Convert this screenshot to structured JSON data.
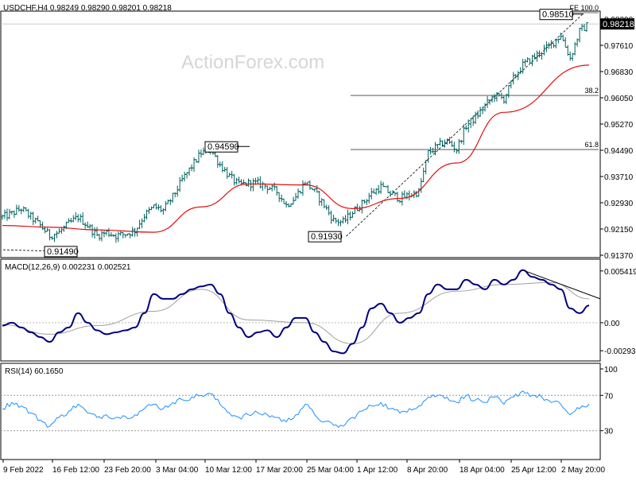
{
  "header": {
    "main": "USDCHF,H4  0.98249 0.98290 0.98201 0.98218",
    "macd": "MACD(12,26,9) 0.002231 0.002521",
    "rsi": "RSI(14) 60.1650"
  },
  "watermark": "ActionForex.com",
  "colors": {
    "background": "#ffffff",
    "bars": "#006060",
    "sma": "#e01010",
    "macd": "#000080",
    "signal": "#a0a0a0",
    "rsi": "#1e90ff",
    "fib": "#404040",
    "trend": "#000000"
  },
  "chart_data": [
    {
      "type": "ohlc",
      "symbol": "USDCHF",
      "timeframe": "H4",
      "ylim": [
        0.9137,
        0.9855
      ],
      "y_ticks": [
        "0.98390",
        "0.97610",
        "0.96830",
        "0.96050",
        "0.95270",
        "0.94490",
        "0.93710",
        "0.92930",
        "0.92150",
        "0.91370"
      ],
      "x_ticks": [
        "9 Feb 2022",
        "16 Feb 12:00",
        "23 Feb 20:00",
        "3 Mar 04:00",
        "10 Mar 12:00",
        "17 Mar 20:00",
        "25 Mar 04:00",
        "1 Apr 12:00",
        "8 Apr 20:00",
        "18 Apr 04:00",
        "25 Apr 12:00",
        "2 May 20:00"
      ],
      "close_keypoints": [
        [
          "9 Feb 2022",
          0.925
        ],
        [
          "10 Feb",
          0.926
        ],
        [
          "11 Feb",
          0.9275
        ],
        [
          "14 Feb",
          0.925
        ],
        [
          "15 Feb",
          0.9225
        ],
        [
          "16 Feb 12:00",
          0.9195
        ],
        [
          "17 Feb",
          0.9205
        ],
        [
          "18 Feb",
          0.923
        ],
        [
          "21 Feb",
          0.925
        ],
        [
          "22 Feb",
          0.9225
        ],
        [
          "23 Feb 20:00",
          0.9195
        ],
        [
          "24 Feb",
          0.9205
        ],
        [
          "25 Feb",
          0.9195
        ],
        [
          "28 Feb",
          0.92
        ],
        [
          "1 Mar",
          0.921
        ],
        [
          "2 Mar",
          0.9255
        ],
        [
          "3 Mar 04:00",
          0.928
        ],
        [
          "4 Mar",
          0.927
        ],
        [
          "7 Mar",
          0.931
        ],
        [
          "8 Mar",
          0.936
        ],
        [
          "9 Mar",
          0.94
        ],
        [
          "10 Mar 12:00",
          0.944
        ],
        [
          "11 Mar",
          0.945
        ],
        [
          "14 Mar",
          0.9405
        ],
        [
          "15 Mar",
          0.937
        ],
        [
          "16 Mar",
          0.9345
        ],
        [
          "17 Mar 20:00",
          0.935
        ],
        [
          "18 Mar",
          0.935
        ],
        [
          "21 Mar",
          0.934
        ],
        [
          "22 Mar",
          0.9325
        ],
        [
          "23 Mar",
          0.9285
        ],
        [
          "24 Mar",
          0.931
        ],
        [
          "25 Mar 04:00",
          0.9355
        ],
        [
          "28 Mar",
          0.9325
        ],
        [
          "29 Mar",
          0.9285
        ],
        [
          "30 Mar",
          0.924
        ],
        [
          "31 Mar",
          0.9235
        ],
        [
          "1 Apr 12:00",
          0.9265
        ],
        [
          "4 Apr",
          0.929
        ],
        [
          "5 Apr",
          0.932
        ],
        [
          "6 Apr",
          0.934
        ],
        [
          "7 Apr",
          0.932
        ],
        [
          "8 Apr 20:00",
          0.9305
        ],
        [
          "11 Apr",
          0.9315
        ],
        [
          "12 Apr",
          0.9325
        ],
        [
          "13 Apr",
          0.944
        ],
        [
          "14 Apr",
          0.946
        ],
        [
          "15 Apr",
          0.9475
        ],
        [
          "18 Apr 04:00",
          0.945
        ],
        [
          "19 Apr",
          0.952
        ],
        [
          "20 Apr",
          0.9545
        ],
        [
          "21 Apr",
          0.958
        ],
        [
          "22 Apr",
          0.961
        ],
        [
          "25 Apr 12:00",
          0.96
        ],
        [
          "26 Apr",
          0.966
        ],
        [
          "27 Apr",
          0.97
        ],
        [
          "28 Apr",
          0.972
        ],
        [
          "29 Apr",
          0.974
        ],
        [
          "2 May 20:00",
          0.976
        ],
        [
          "3 May",
          0.979
        ],
        [
          "4 May",
          0.972
        ],
        [
          "5 May",
          0.98
        ],
        [
          "6 May",
          0.9822
        ]
      ],
      "sma_keypoints": [
        [
          "9 Feb 2022",
          0.9225
        ],
        [
          "16 Feb 12:00",
          0.922
        ],
        [
          "23 Feb 20:00",
          0.9212
        ],
        [
          "3 Mar 04:00",
          0.9205
        ],
        [
          "10 Mar 12:00",
          0.928
        ],
        [
          "17 Mar 20:00",
          0.9348
        ],
        [
          "25 Mar 04:00",
          0.9345
        ],
        [
          "1 Apr 12:00",
          0.9275
        ],
        [
          "8 Apr 20:00",
          0.9305
        ],
        [
          "18 Apr 04:00",
          0.941
        ],
        [
          "25 Apr 12:00",
          0.956
        ],
        [
          "2 May 20:00",
          0.97
        ]
      ],
      "annotations": [
        {
          "text": "0.91490",
          "value": 0.9149
        },
        {
          "text": "0.94590",
          "value": 0.9459
        },
        {
          "text": "0.91930",
          "value": 0.9193
        },
        {
          "text": "0.98510",
          "value": 0.9851
        },
        {
          "text": "0.98218",
          "value": 0.98218
        }
      ],
      "fib_levels": [
        {
          "label": "FE 100.0",
          "value": 0.9855
        },
        {
          "label": "38.2",
          "value": 0.961
        },
        {
          "label": "61.8",
          "value": 0.945
        }
      ],
      "grid": false
    },
    {
      "type": "line",
      "name": "MACD(12,26,9)",
      "ylim": [
        -0.0035,
        0.0059
      ],
      "y_ticks": [
        "0.005419",
        "0.00",
        "-0.00293"
      ],
      "macd_keypoints": [
        [
          "9 Feb 2022",
          -0.0003
        ],
        [
          "10 Feb",
          0.0
        ],
        [
          "11 Feb",
          -0.0005
        ],
        [
          "14 Feb",
          -0.001
        ],
        [
          "15 Feb",
          -0.0015
        ],
        [
          "16 Feb 12:00",
          -0.002
        ],
        [
          "17 Feb",
          -0.001
        ],
        [
          "18 Feb",
          -0.0005
        ],
        [
          "21 Feb",
          0.001
        ],
        [
          "22 Feb",
          0.0
        ],
        [
          "23 Feb 20:00",
          -0.0008
        ],
        [
          "24 Feb",
          -0.0012
        ],
        [
          "25 Feb",
          -0.001
        ],
        [
          "28 Feb",
          -0.0008
        ],
        [
          "1 Mar",
          -0.0005
        ],
        [
          "2 Mar",
          0.001
        ],
        [
          "3 Mar 04:00",
          0.003
        ],
        [
          "4 Mar",
          0.0025
        ],
        [
          "7 Mar",
          0.0025
        ],
        [
          "8 Mar",
          0.003
        ],
        [
          "9 Mar",
          0.0035
        ],
        [
          "10 Mar 12:00",
          0.0038
        ],
        [
          "11 Mar",
          0.004
        ],
        [
          "14 Mar",
          0.003
        ],
        [
          "15 Mar",
          0.001
        ],
        [
          "16 Mar",
          -0.0005
        ],
        [
          "17 Mar 20:00",
          -0.0015
        ],
        [
          "18 Mar",
          -0.001
        ],
        [
          "21 Mar",
          -0.0008
        ],
        [
          "22 Mar",
          -0.0015
        ],
        [
          "23 Mar",
          -0.0005
        ],
        [
          "24 Mar",
          0.0005
        ],
        [
          "25 Mar 04:00",
          0.0005
        ],
        [
          "28 Mar",
          -0.001
        ],
        [
          "29 Mar",
          -0.002
        ],
        [
          "30 Mar",
          -0.003
        ],
        [
          "31 Mar",
          -0.0032
        ],
        [
          "1 Apr 12:00",
          -0.0022
        ],
        [
          "4 Apr",
          -0.0005
        ],
        [
          "5 Apr",
          0.0015
        ],
        [
          "6 Apr",
          0.002
        ],
        [
          "7 Apr",
          0.001
        ],
        [
          "8 Apr 20:00",
          0.0
        ],
        [
          "11 Apr",
          0.0005
        ],
        [
          "12 Apr",
          0.001
        ],
        [
          "13 Apr",
          0.003
        ],
        [
          "14 Apr",
          0.004
        ],
        [
          "15 Apr",
          0.0035
        ],
        [
          "18 Apr 04:00",
          0.0035
        ],
        [
          "19 Apr",
          0.0045
        ],
        [
          "20 Apr",
          0.004
        ],
        [
          "21 Apr",
          0.0035
        ],
        [
          "22 Apr",
          0.0045
        ],
        [
          "25 Apr 12:00",
          0.004
        ],
        [
          "26 Apr",
          0.0045
        ],
        [
          "27 Apr",
          0.0055
        ],
        [
          "28 Apr",
          0.0048
        ],
        [
          "29 Apr",
          0.0045
        ],
        [
          "2 May 20:00",
          0.004
        ],
        [
          "3 May",
          0.0035
        ],
        [
          "4 May",
          0.0015
        ],
        [
          "5 May",
          0.001
        ],
        [
          "6 May",
          0.0018
        ]
      ],
      "signal_keypoints": [
        [
          "9 Feb 2022",
          -0.0002
        ],
        [
          "16 Feb 12:00",
          -0.0012
        ],
        [
          "23 Feb 20:00",
          -0.0003
        ],
        [
          "3 Mar 04:00",
          0.0012
        ],
        [
          "10 Mar 12:00",
          0.0035
        ],
        [
          "17 Mar 20:00",
          0.0003
        ],
        [
          "25 Mar 04:00",
          0.0
        ],
        [
          "1 Apr 12:00",
          -0.0022
        ],
        [
          "8 Apr 20:00",
          0.001
        ],
        [
          "18 Apr 04:00",
          0.0033
        ],
        [
          "25 Apr 12:00",
          0.004
        ],
        [
          "2 May 20:00",
          0.0042
        ],
        [
          "6 May",
          0.0025
        ]
      ],
      "trendline": [
        [
          "27 Apr",
          0.0055
        ],
        [
          "6 May",
          0.003
        ]
      ]
    },
    {
      "type": "line",
      "name": "RSI(14)",
      "ylim": [
        0,
        100
      ],
      "y_ticks": [
        "100",
        "70",
        "30"
      ],
      "levels": [
        70,
        30
      ],
      "rsi_keypoints": [
        [
          "9 Feb 2022",
          55
        ],
        [
          "10 Feb",
          62
        ],
        [
          "11 Feb",
          58
        ],
        [
          "14 Feb",
          50
        ],
        [
          "15 Feb",
          42
        ],
        [
          "16 Feb 12:00",
          35
        ],
        [
          "17 Feb",
          45
        ],
        [
          "18 Feb",
          52
        ],
        [
          "21 Feb",
          60
        ],
        [
          "22 Feb",
          50
        ],
        [
          "23 Feb 20:00",
          45
        ],
        [
          "24 Feb",
          48
        ],
        [
          "25 Feb",
          45
        ],
        [
          "28 Feb",
          46
        ],
        [
          "1 Mar",
          48
        ],
        [
          "2 Mar",
          55
        ],
        [
          "3 Mar 04:00",
          60
        ],
        [
          "4 Mar",
          55
        ],
        [
          "7 Mar",
          62
        ],
        [
          "8 Mar",
          65
        ],
        [
          "9 Mar",
          68
        ],
        [
          "10 Mar 12:00",
          70
        ],
        [
          "11 Mar",
          72
        ],
        [
          "14 Mar",
          60
        ],
        [
          "15 Mar",
          50
        ],
        [
          "16 Mar",
          45
        ],
        [
          "17 Mar 20:00",
          48
        ],
        [
          "18 Mar",
          50
        ],
        [
          "21 Mar",
          48
        ],
        [
          "22 Mar",
          45
        ],
        [
          "23 Mar",
          40
        ],
        [
          "24 Mar",
          48
        ],
        [
          "25 Mar 04:00",
          60
        ],
        [
          "28 Mar",
          48
        ],
        [
          "29 Mar",
          40
        ],
        [
          "30 Mar",
          36
        ],
        [
          "31 Mar",
          35
        ],
        [
          "1 Apr 12:00",
          45
        ],
        [
          "4 Apr",
          52
        ],
        [
          "5 Apr",
          58
        ],
        [
          "6 Apr",
          62
        ],
        [
          "7 Apr",
          55
        ],
        [
          "8 Apr 20:00",
          50
        ],
        [
          "11 Apr",
          55
        ],
        [
          "12 Apr",
          58
        ],
        [
          "13 Apr",
          68
        ],
        [
          "14 Apr",
          70
        ],
        [
          "15 Apr",
          68
        ],
        [
          "18 Apr 04:00",
          62
        ],
        [
          "19 Apr",
          70
        ],
        [
          "20 Apr",
          65
        ],
        [
          "21 Apr",
          62
        ],
        [
          "22 Apr",
          68
        ],
        [
          "25 Apr 12:00",
          60
        ],
        [
          "26 Apr",
          68
        ],
        [
          "27 Apr",
          75
        ],
        [
          "28 Apr",
          70
        ],
        [
          "29 Apr",
          68
        ],
        [
          "2 May 20:00",
          62
        ],
        [
          "3 May",
          60
        ],
        [
          "4 May",
          48
        ],
        [
          "5 May",
          55
        ],
        [
          "6 May",
          60.165
        ]
      ]
    }
  ]
}
